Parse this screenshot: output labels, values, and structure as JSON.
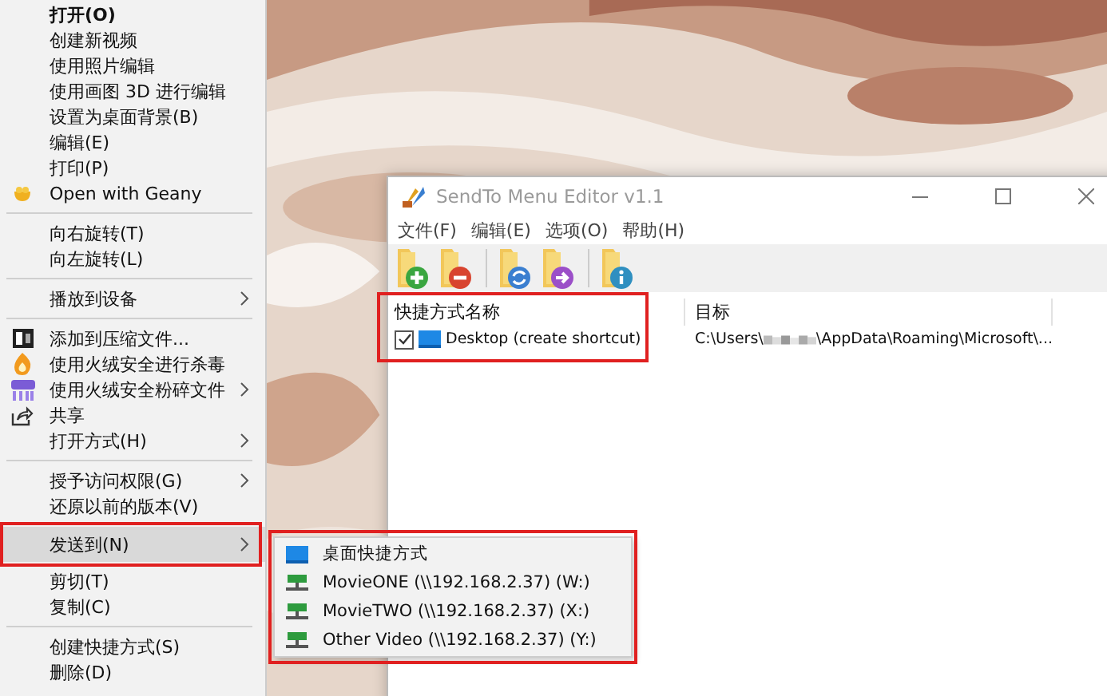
{
  "context_menu": {
    "items": [
      {
        "kind": "item",
        "label": "打开(O)",
        "default": true,
        "selected": false
      },
      {
        "kind": "item",
        "label": "创建新视频",
        "default": false,
        "selected": false
      },
      {
        "kind": "item",
        "label": "使用照片编辑",
        "default": false,
        "selected": false
      },
      {
        "kind": "item",
        "label": "使用画图 3D 进行编辑",
        "default": false,
        "selected": false
      },
      {
        "kind": "item",
        "label": "设置为桌面背景(B)",
        "default": false,
        "selected": false
      },
      {
        "kind": "item",
        "label": "编辑(E)",
        "default": false,
        "selected": false
      },
      {
        "kind": "item",
        "label": "打印(P)",
        "default": false,
        "selected": false
      },
      {
        "kind": "item",
        "label": "Open with Geany",
        "default": false,
        "selected": false
      },
      {
        "kind": "separator"
      },
      {
        "kind": "item",
        "label": "向右旋转(T)",
        "default": false,
        "selected": false
      },
      {
        "kind": "item",
        "label": "向左旋转(L)",
        "default": false,
        "selected": false
      },
      {
        "kind": "separator"
      },
      {
        "kind": "submenu",
        "label": "播放到设备",
        "default": false,
        "selected": false
      },
      {
        "kind": "separator"
      },
      {
        "kind": "item",
        "label": "添加到压缩文件...",
        "default": false,
        "selected": false
      },
      {
        "kind": "item",
        "label": "使用火绒安全进行杀毒",
        "default": false,
        "selected": false
      },
      {
        "kind": "submenu",
        "label": "使用火绒安全粉碎文件",
        "default": false,
        "selected": false
      },
      {
        "kind": "item",
        "label": "共享",
        "default": false,
        "selected": false
      },
      {
        "kind": "submenu",
        "label": "打开方式(H)",
        "default": false,
        "selected": false
      },
      {
        "kind": "separator"
      },
      {
        "kind": "submenu",
        "label": "授予访问权限(G)",
        "default": false,
        "selected": false
      },
      {
        "kind": "item",
        "label": "还原以前的版本(V)",
        "default": false,
        "selected": false
      },
      {
        "kind": "submenu",
        "label": "发送到(N)",
        "default": false,
        "selected": true
      },
      {
        "kind": "item",
        "label": "剪切(T)",
        "default": false,
        "selected": false
      },
      {
        "kind": "item",
        "label": "复制(C)",
        "default": false,
        "selected": false
      },
      {
        "kind": "separator"
      },
      {
        "kind": "item",
        "label": "创建快捷方式(S)",
        "default": false,
        "selected": false
      },
      {
        "kind": "item",
        "label": "删除(D)",
        "default": false,
        "selected": false
      }
    ]
  },
  "send_to_submenu": {
    "items": [
      {
        "label": "桌面快捷方式"
      },
      {
        "label": "MovieONE (\\\\192.168.2.37) (W:)"
      },
      {
        "label": "MovieTWO (\\\\192.168.2.37) (X:)"
      },
      {
        "label": "Other Video (\\\\192.168.2.37) (Y:)"
      }
    ]
  },
  "window": {
    "title": "SendTo Menu Editor v1.1",
    "menu": [
      "文件(F)",
      "编辑(E)",
      "选项(O)",
      "帮助(H)"
    ],
    "toolbar": [
      {
        "kind": "button"
      },
      {
        "kind": "button"
      },
      {
        "kind": "separator"
      },
      {
        "kind": "button"
      },
      {
        "kind": "button"
      },
      {
        "kind": "separator"
      },
      {
        "kind": "button"
      }
    ],
    "table": {
      "columns": [
        "快捷方式名称",
        "目标"
      ],
      "rows": [
        {
          "checked": true,
          "name": "Desktop (create shortcut)",
          "target_start": "C:\\Users\\",
          "target_end": "\\AppData\\Roaming\\Microsoft\\..."
        }
      ]
    }
  }
}
